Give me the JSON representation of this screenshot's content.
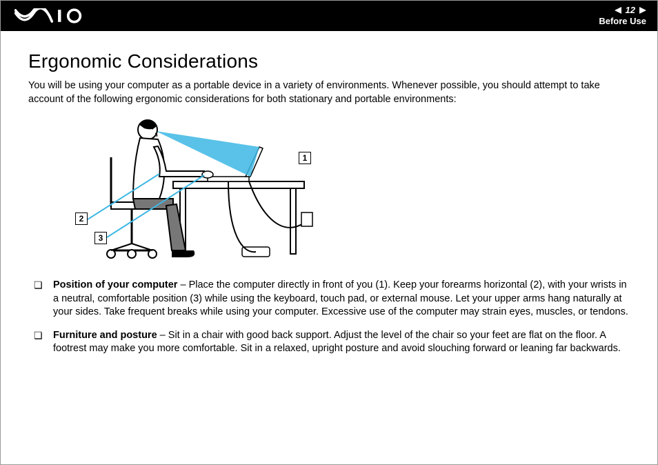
{
  "header": {
    "page_number": "12",
    "section": "Before Use"
  },
  "title": "Ergonomic Considerations",
  "intro": "You will be using your computer as a portable device in a variety of environments. Whenever possible, you should attempt to take account of the following ergonomic considerations for both stationary and portable environments:",
  "illustration": {
    "callouts": {
      "1": "1",
      "2": "2",
      "3": "3"
    }
  },
  "bullets": [
    {
      "lead": "Position of your computer",
      "text": " – Place the computer directly in front of you (1). Keep your forearms horizontal (2), with your wrists in a neutral, comfortable position (3) while using the keyboard, touch pad, or external mouse. Let your upper arms hang naturally at your sides. Take frequent breaks while using your computer. Excessive use of the computer may strain eyes, muscles, or tendons."
    },
    {
      "lead": "Furniture and posture",
      "text": " – Sit in a chair with good back support. Adjust the level of the chair so your feet are flat on the floor. A footrest may make you more comfortable. Sit in a relaxed, upright posture and avoid slouching forward or leaning far backwards."
    }
  ]
}
